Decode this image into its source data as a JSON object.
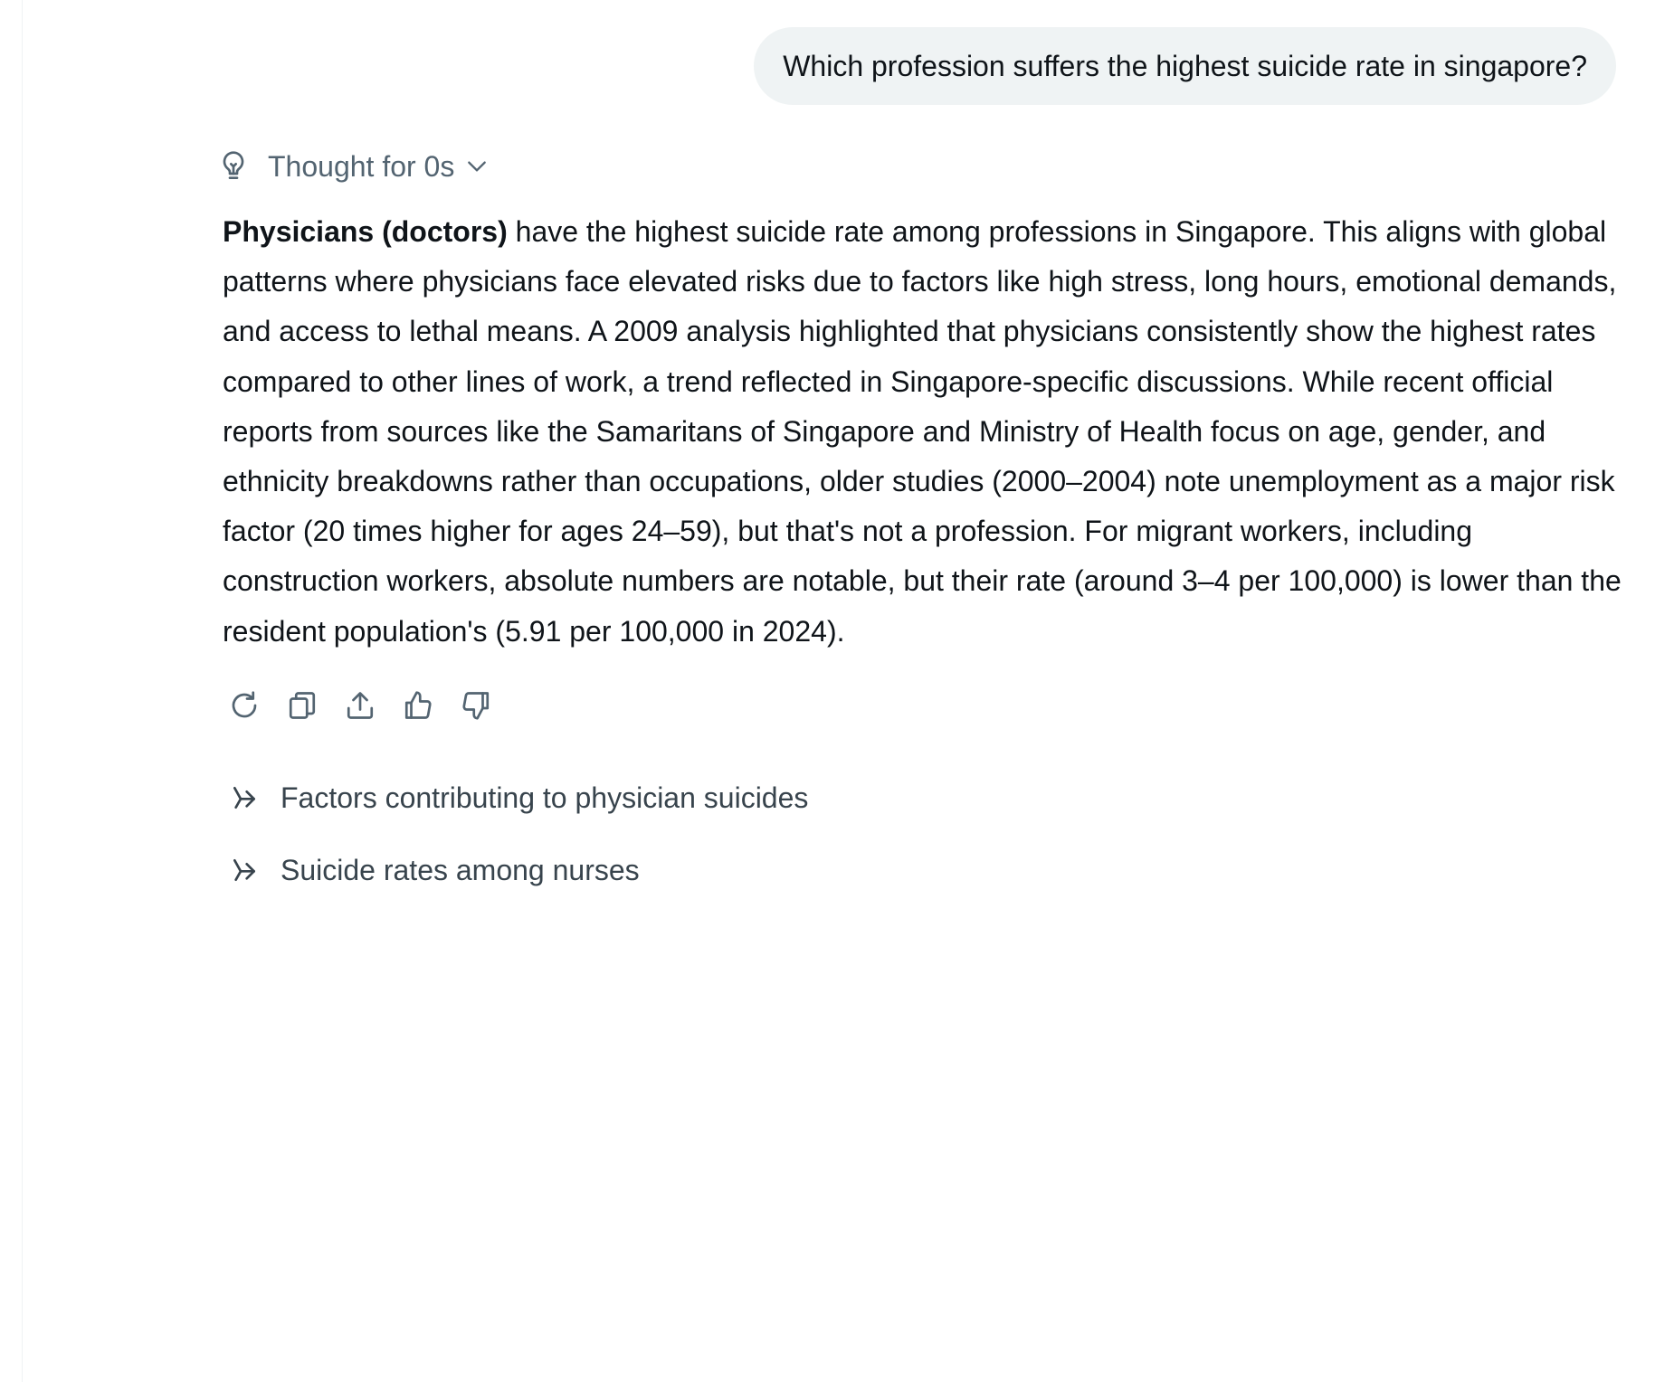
{
  "user_message": "Which profession suffers the highest suicide rate in singapore?",
  "thought": {
    "label": "Thought for 0s",
    "icon": "lightbulb-icon",
    "toggle_icon": "chevron-down-icon"
  },
  "answer": {
    "bold_lead": "Physicians (doctors)",
    "body": " have the highest suicide rate among professions in Singapore. This aligns with global patterns where physicians face elevated risks due to factors like high stress, long hours, emotional demands, and access to lethal means. A 2009 analysis highlighted that physicians consistently show the highest rates compared to other lines of work, a trend reflected in Singapore-specific discussions. While recent official reports from sources like the Samaritans of Singapore and Ministry of Health focus on age, gender, and ethnicity breakdowns rather than occupations, older studies (2000–2004) note unemployment as a major risk factor (20 times higher for ages 24–59), but that's not a profession. For migrant workers, including construction workers, absolute numbers are notable, but their rate (around 3–4 per 100,000) is lower than the resident population's (5.91 per 100,000 in 2024)."
  },
  "actions": [
    {
      "name": "regenerate",
      "icon": "refresh-icon"
    },
    {
      "name": "copy",
      "icon": "copy-icon"
    },
    {
      "name": "share",
      "icon": "share-icon"
    },
    {
      "name": "like",
      "icon": "thumbs-up-icon"
    },
    {
      "name": "dislike",
      "icon": "thumbs-down-icon"
    }
  ],
  "follow_ups": [
    {
      "label": "Factors contributing to physician suicides",
      "icon": "follow-up-arrow-icon"
    },
    {
      "label": "Suicide rates among nurses",
      "icon": "follow-up-arrow-icon"
    }
  ],
  "colors": {
    "bubble_bg": "#eff3f4",
    "text_primary": "#0f1419",
    "text_secondary": "#536471"
  }
}
